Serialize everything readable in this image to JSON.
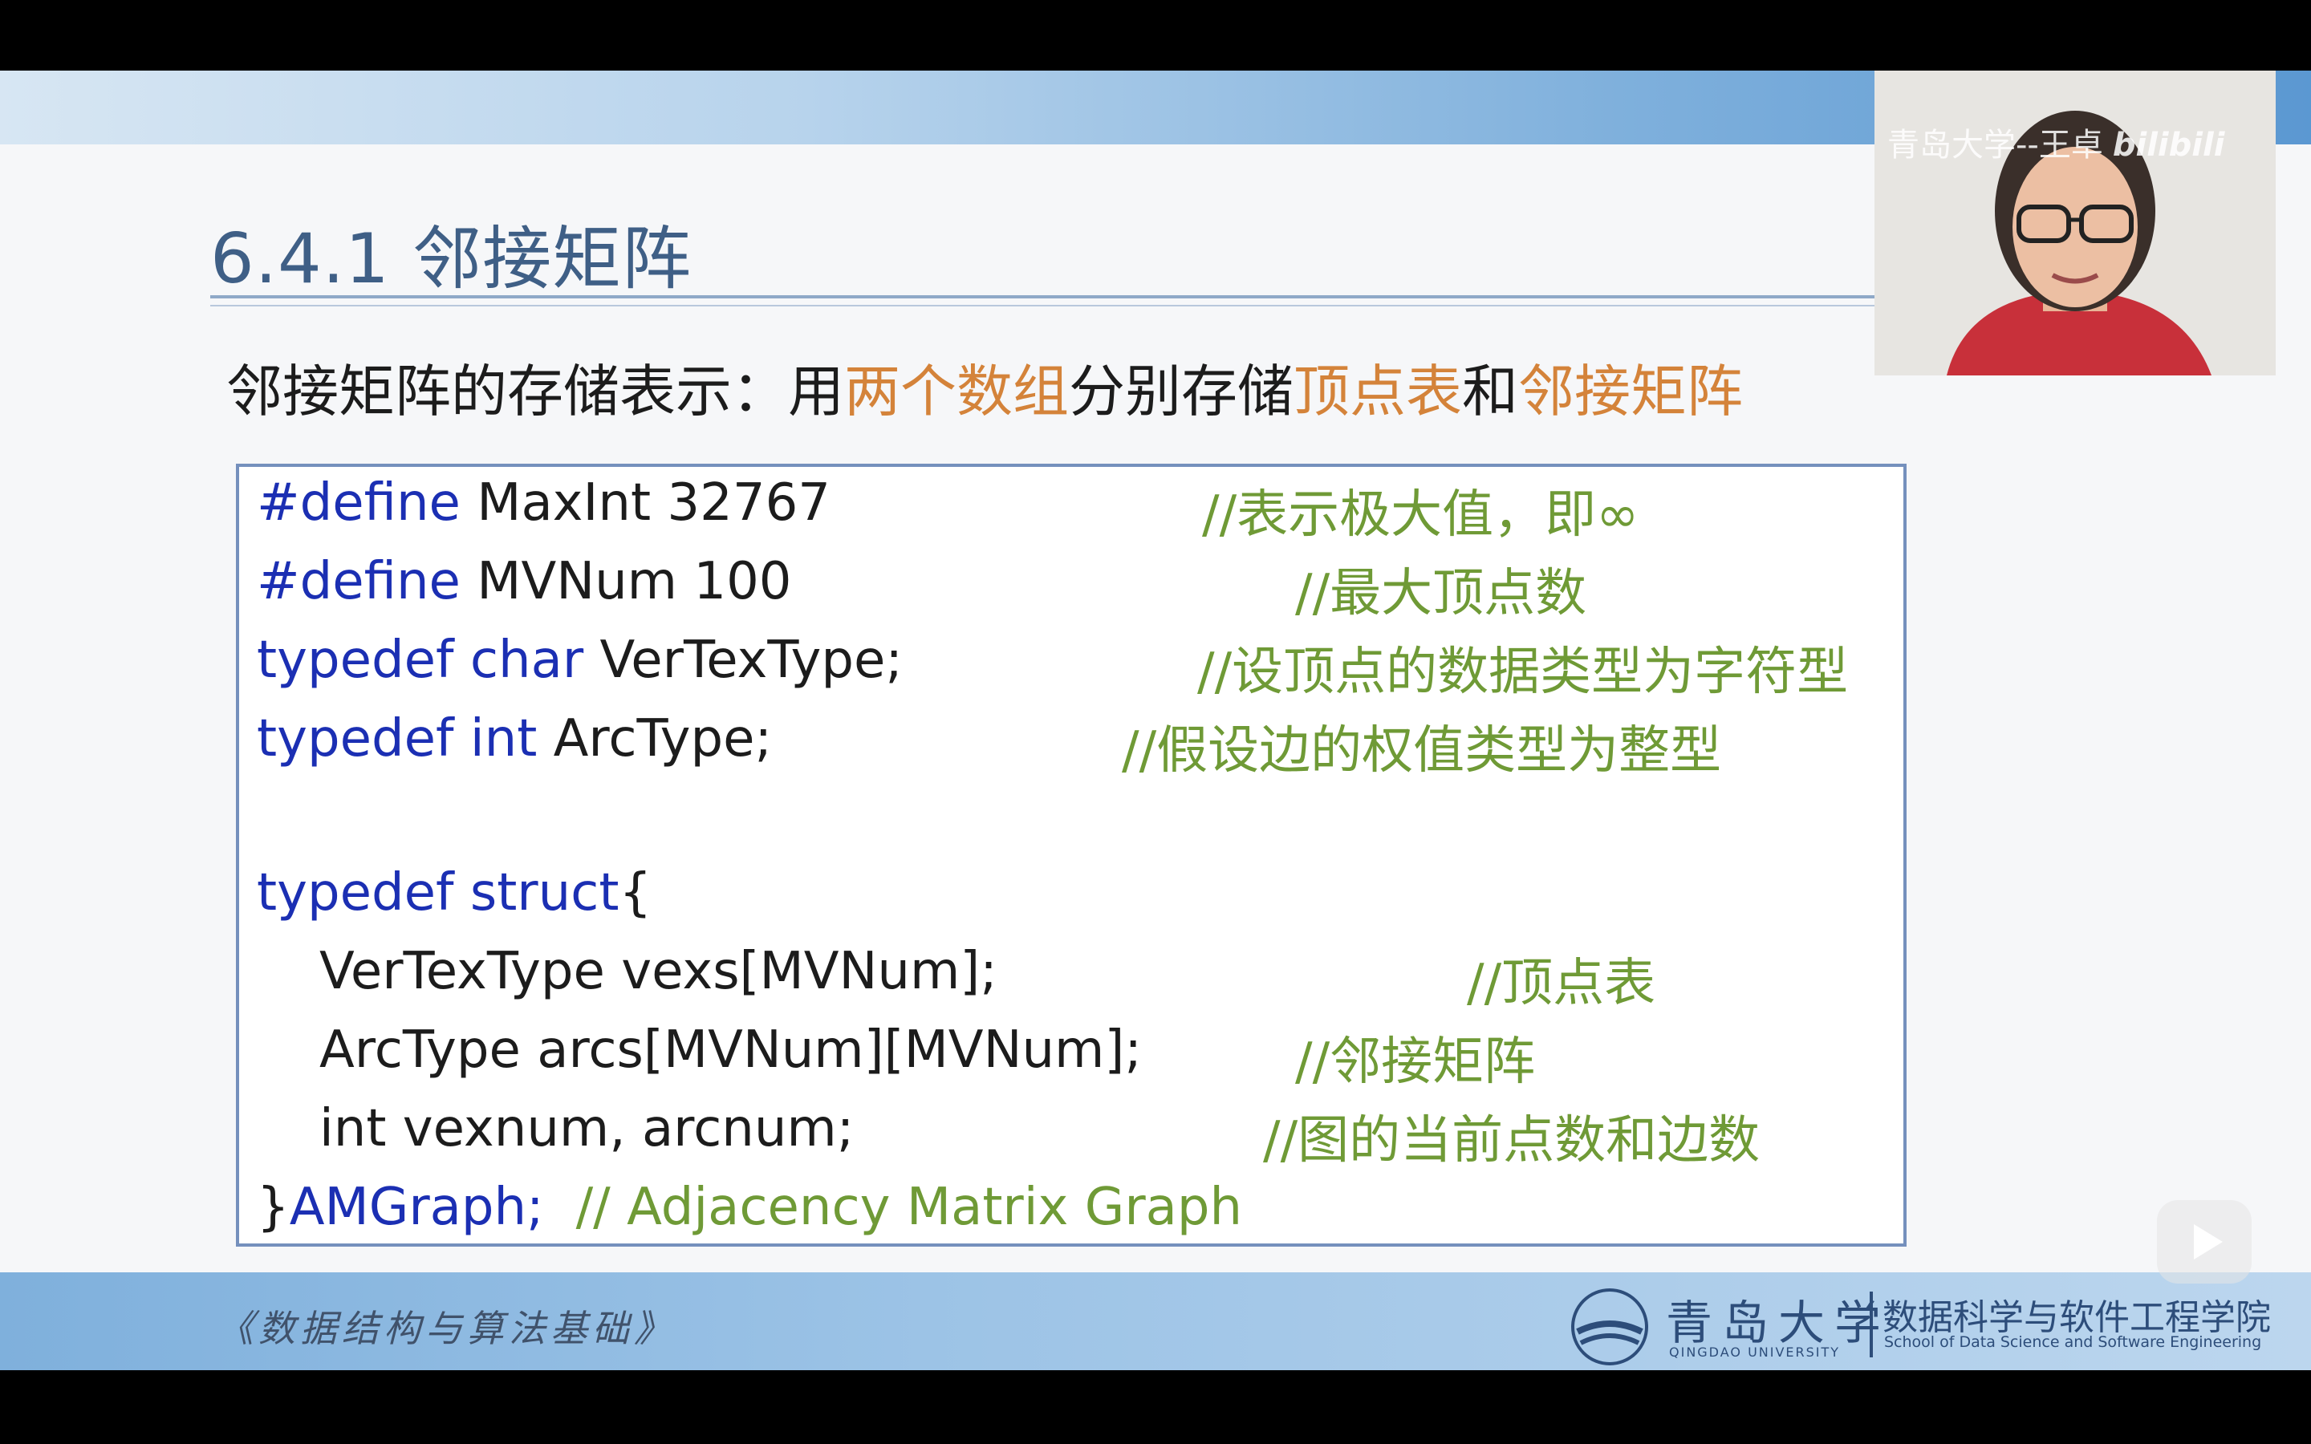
{
  "slide": {
    "title": "6.4.1 邻接矩阵",
    "subtitle": {
      "part1": "邻接矩阵的存储表示：用",
      "hl1": "两个数组",
      "part2": "分别存储",
      "hl2": "顶点表",
      "part3": "和",
      "hl3": "邻接矩阵"
    }
  },
  "code": {
    "line1": {
      "kw": "#define",
      "text": " MaxInt 32767",
      "comment": "//表示极大值，即∞"
    },
    "line2": {
      "kw": "#define",
      "text": " MVNum 100",
      "comment": "//最大顶点数"
    },
    "line3": {
      "kw": "typedef char",
      "text": " VerTexType;",
      "comment": "//设顶点的数据类型为字符型"
    },
    "line4": {
      "kw": "typedef int",
      "text": " ArcType;",
      "comment": "//假设边的权值类型为整型"
    },
    "line5": {
      "kw": "typedef struct",
      "text": "{"
    },
    "line6": {
      "text": "VerTexType vexs[MVNum];",
      "comment": "//顶点表"
    },
    "line7": {
      "text": "ArcType arcs[MVNum][MVNum];",
      "comment": "//邻接矩阵"
    },
    "line8": {
      "text": "int vexnum, arcnum;",
      "comment": "//图的当前点数和边数"
    },
    "line9": {
      "brace": "}",
      "name": "AMGraph;",
      "comment": "// Adjacency Matrix Graph"
    }
  },
  "footer": {
    "course": "《数据结构与算法基础》",
    "university_cn": "青岛大学",
    "university_en": "QINGDAO UNIVERSITY",
    "school_cn": "数据科学与软件工程学院",
    "school_en": "School of Data Science and Software Engineering"
  },
  "webcam": {
    "watermark": "青岛大学--王卓",
    "platform_logo": "bilibili"
  },
  "player": {
    "play_icon": "play-icon"
  },
  "colors": {
    "title": "#3f5f86",
    "highlight": "#d4833a",
    "keyword": "#1b2fb3",
    "comment": "#6f9a36",
    "border": "#7590bd"
  }
}
